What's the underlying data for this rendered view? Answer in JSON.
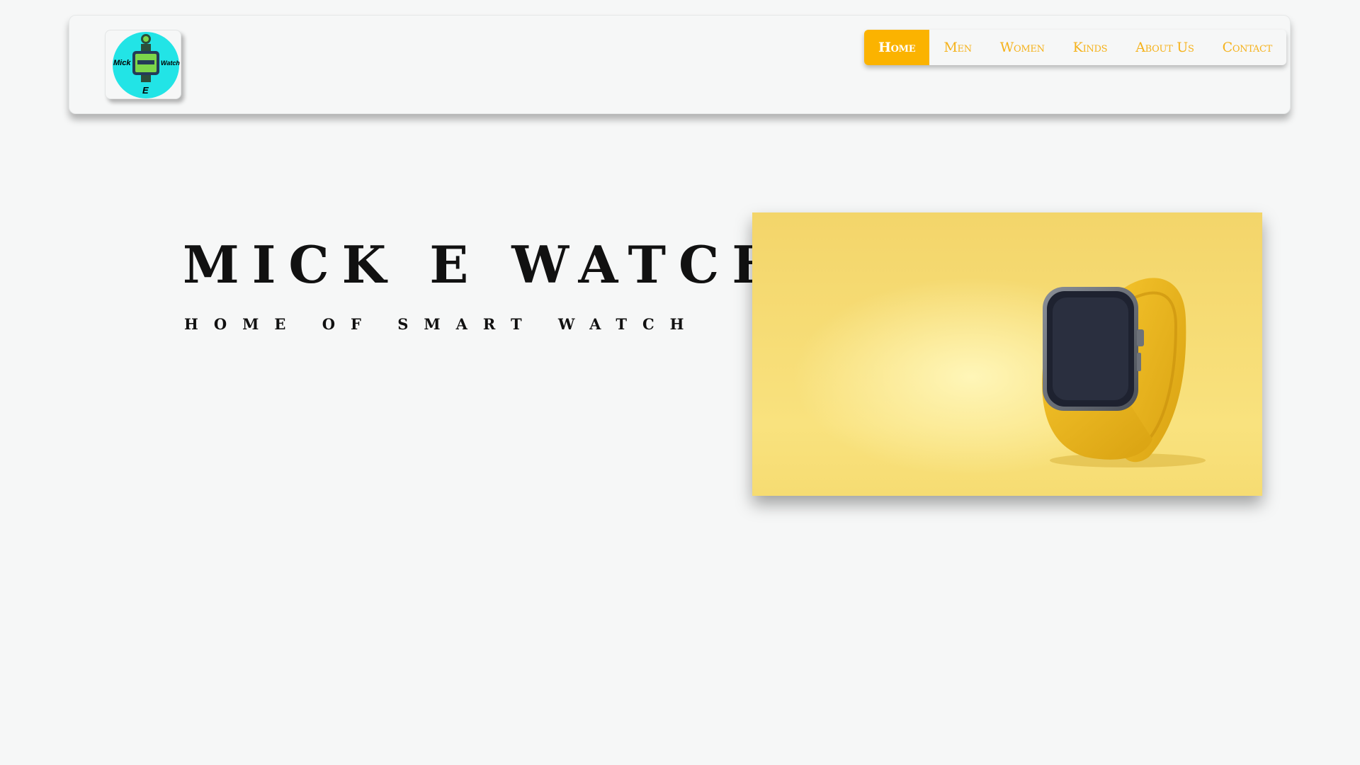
{
  "header": {
    "logo": {
      "icon": "smartwatch-logo-icon",
      "text_left": "Mick",
      "text_right": "Watch",
      "text_bottom": "E",
      "colors": {
        "circle": "#22e4e6",
        "screen": "#7cd64a"
      }
    },
    "nav": {
      "items": [
        {
          "label": "Home",
          "active": true
        },
        {
          "label": "Men",
          "active": false
        },
        {
          "label": "Women",
          "active": false
        },
        {
          "label": "Kinds",
          "active": false
        },
        {
          "label": "About Us",
          "active": false
        },
        {
          "label": "Contact",
          "active": false
        }
      ],
      "colors": {
        "active_bg": "#fbb300",
        "text": "#f5b21b"
      }
    }
  },
  "hero": {
    "title": "MICK E WATCH",
    "subtitle": "HOME OF SMART WATCH",
    "image": {
      "description_icon": "yellow-smartwatch-image",
      "background": "#f8dd73"
    }
  }
}
